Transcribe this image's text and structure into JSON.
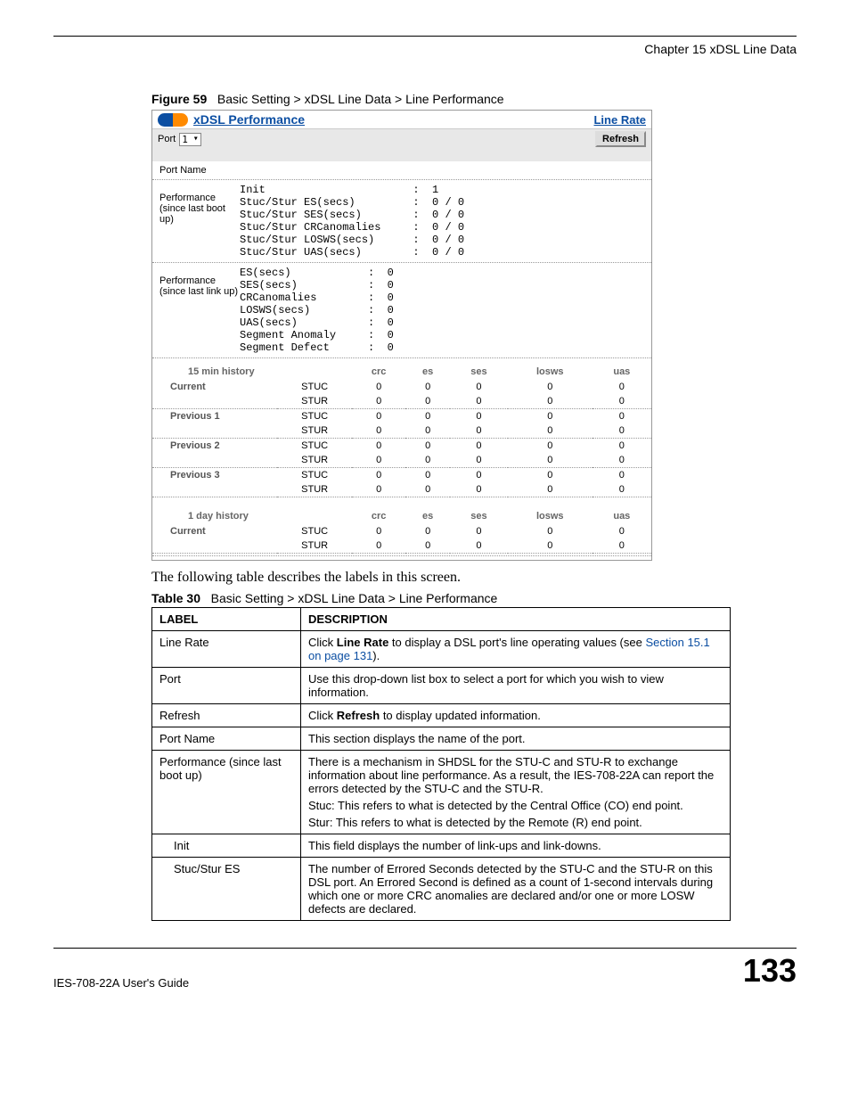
{
  "header": {
    "chapter": "Chapter 15 xDSL Line Data"
  },
  "figure": {
    "label": "Figure 59",
    "caption": "Basic Setting > xDSL Line Data > Line Performance"
  },
  "screenshot": {
    "title": "xDSL Performance",
    "link_rate": "Line Rate",
    "port_label": "Port",
    "port_value": "1",
    "refresh_label": "Refresh",
    "port_name_label": "Port Name",
    "perf_boot_label": "Performance (since last boot up)",
    "perf_boot_text": "Init                       :  1\nStuc/Stur ES(secs)         :  0 / 0\nStuc/Stur SES(secs)        :  0 / 0\nStuc/Stur CRCanomalies     :  0 / 0\nStuc/Stur LOSWS(secs)      :  0 / 0\nStuc/Stur UAS(secs)        :  0 / 0",
    "perf_link_label": "Performance (since last link up)",
    "perf_link_text": "ES(secs)            :  0\nSES(secs)           :  0\nCRCanomalies        :  0\nLOSWS(secs)         :  0\nUAS(secs)           :  0\nSegment Anomaly     :  0\nSegment Defect      :  0",
    "hist15_title": "15 min  history",
    "hist_cols": [
      "crc",
      "es",
      "ses",
      "losws",
      "uas"
    ],
    "hist15_rows": [
      {
        "label": "Current",
        "sub": "STUC",
        "v": [
          "0",
          "0",
          "0",
          "0",
          "0"
        ]
      },
      {
        "label": "",
        "sub": "STUR",
        "v": [
          "0",
          "0",
          "0",
          "0",
          "0"
        ]
      },
      {
        "label": "Previous 1",
        "sub": "STUC",
        "v": [
          "0",
          "0",
          "0",
          "0",
          "0"
        ]
      },
      {
        "label": "",
        "sub": "STUR",
        "v": [
          "0",
          "0",
          "0",
          "0",
          "0"
        ]
      },
      {
        "label": "Previous 2",
        "sub": "STUC",
        "v": [
          "0",
          "0",
          "0",
          "0",
          "0"
        ]
      },
      {
        "label": "",
        "sub": "STUR",
        "v": [
          "0",
          "0",
          "0",
          "0",
          "0"
        ]
      },
      {
        "label": "Previous 3",
        "sub": "STUC",
        "v": [
          "0",
          "0",
          "0",
          "0",
          "0"
        ]
      },
      {
        "label": "",
        "sub": "STUR",
        "v": [
          "0",
          "0",
          "0",
          "0",
          "0"
        ]
      }
    ],
    "hist1d_title": "1 day  history",
    "hist1d_rows": [
      {
        "label": "Current",
        "sub": "STUC",
        "v": [
          "0",
          "0",
          "0",
          "0",
          "0"
        ]
      },
      {
        "label": "",
        "sub": "STUR",
        "v": [
          "0",
          "0",
          "0",
          "0",
          "0"
        ]
      }
    ]
  },
  "body_text": "The following table describes the labels in this screen.",
  "table": {
    "label": "Table 30",
    "caption": "Basic Setting > xDSL Line Data > Line Performance",
    "headers": [
      "LABEL",
      "DESCRIPTION"
    ],
    "rows": [
      {
        "label": "Line Rate",
        "desc_pre": "Click ",
        "desc_bold": "Line Rate",
        "desc_mid": " to display a DSL port's line operating values (see ",
        "desc_link": "Section 15.1 on page 131",
        "desc_post": ")."
      },
      {
        "label": "Port",
        "desc": "Use this drop-down list box to select a port for which you wish to view information."
      },
      {
        "label": "Refresh",
        "desc_pre": "Click ",
        "desc_bold": "Refresh",
        "desc_post": " to display updated information."
      },
      {
        "label": "Port Name",
        "desc": "This section displays the name of the port."
      },
      {
        "label": "Performance (since last boot up)",
        "desc": "There is a mechanism in SHDSL for the STU-C and STU-R to exchange information about line performance. As a result, the IES-708-22A can report the errors detected by the STU-C and the STU-R.\nStuc: This refers to what is detected by the Central Office (CO) end point.\nStur: This refers to what is detected by the Remote (R) end point."
      },
      {
        "label": "Init",
        "indent": true,
        "desc": "This field displays the number of link-ups and link-downs."
      },
      {
        "label": "Stuc/Stur ES",
        "indent": true,
        "desc": "The number of Errored Seconds detected by the STU-C and the STU-R on this DSL port. An Errored Second is defined as a count of 1-second intervals during which one or more CRC anomalies are declared and/or one or more LOSW defects are declared."
      }
    ]
  },
  "footer": {
    "guide": "IES-708-22A User's Guide",
    "page": "133"
  }
}
